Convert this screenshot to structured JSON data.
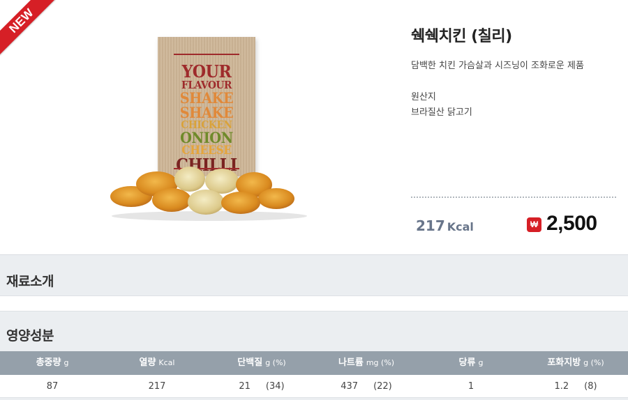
{
  "badge": "NEW",
  "product": {
    "name": "쉑쉑치킨 (칠리)",
    "description": "담백한 치킨 가슴살과 시즈닝이 조화로운 제품",
    "origin_label": "원산지",
    "origin_value": "브라질산 닭고기",
    "kcal_value": "217",
    "kcal_unit": "Kcal",
    "price_icon": "₩",
    "price": "2,500",
    "package_lines": [
      {
        "text": "YOUR",
        "color": "#9e2a2b"
      },
      {
        "text": "FLAVOUR",
        "color": "#9e2a2b"
      },
      {
        "text": "SHAKE",
        "color": "#e0893a"
      },
      {
        "text": "SHAKE",
        "color": "#e0893a"
      },
      {
        "text": "CHICKEN",
        "color": "#d9a23a"
      },
      {
        "text": "ONION",
        "color": "#6f8a2a"
      },
      {
        "text": "CHEESE",
        "color": "#e5a53c"
      },
      {
        "text": "CHILLI",
        "color": "#7a2421"
      }
    ]
  },
  "sections": {
    "ingredients_title": "재료소개",
    "nutrition_title": "영양성분"
  },
  "nutrition": {
    "headers": [
      {
        "label": "총중량",
        "unit": "g"
      },
      {
        "label": "열량",
        "unit": "Kcal"
      },
      {
        "label": "단백질",
        "unit": "g (%)"
      },
      {
        "label": "나트륨",
        "unit": "mg (%)"
      },
      {
        "label": "당류",
        "unit": "g"
      },
      {
        "label": "포화지방",
        "unit": "g (%)"
      }
    ],
    "values": [
      {
        "value": "87",
        "pct": ""
      },
      {
        "value": "217",
        "pct": ""
      },
      {
        "value": "21",
        "pct": "(34)"
      },
      {
        "value": "437",
        "pct": "(22)"
      },
      {
        "value": "1",
        "pct": ""
      },
      {
        "value": "1.2",
        "pct": "(8)"
      }
    ]
  },
  "colors": {
    "accent_red": "#d61f26",
    "kcal_text": "#68758a",
    "table_header_bg": "#95a0aa",
    "page_bg": "#ebeef1"
  }
}
